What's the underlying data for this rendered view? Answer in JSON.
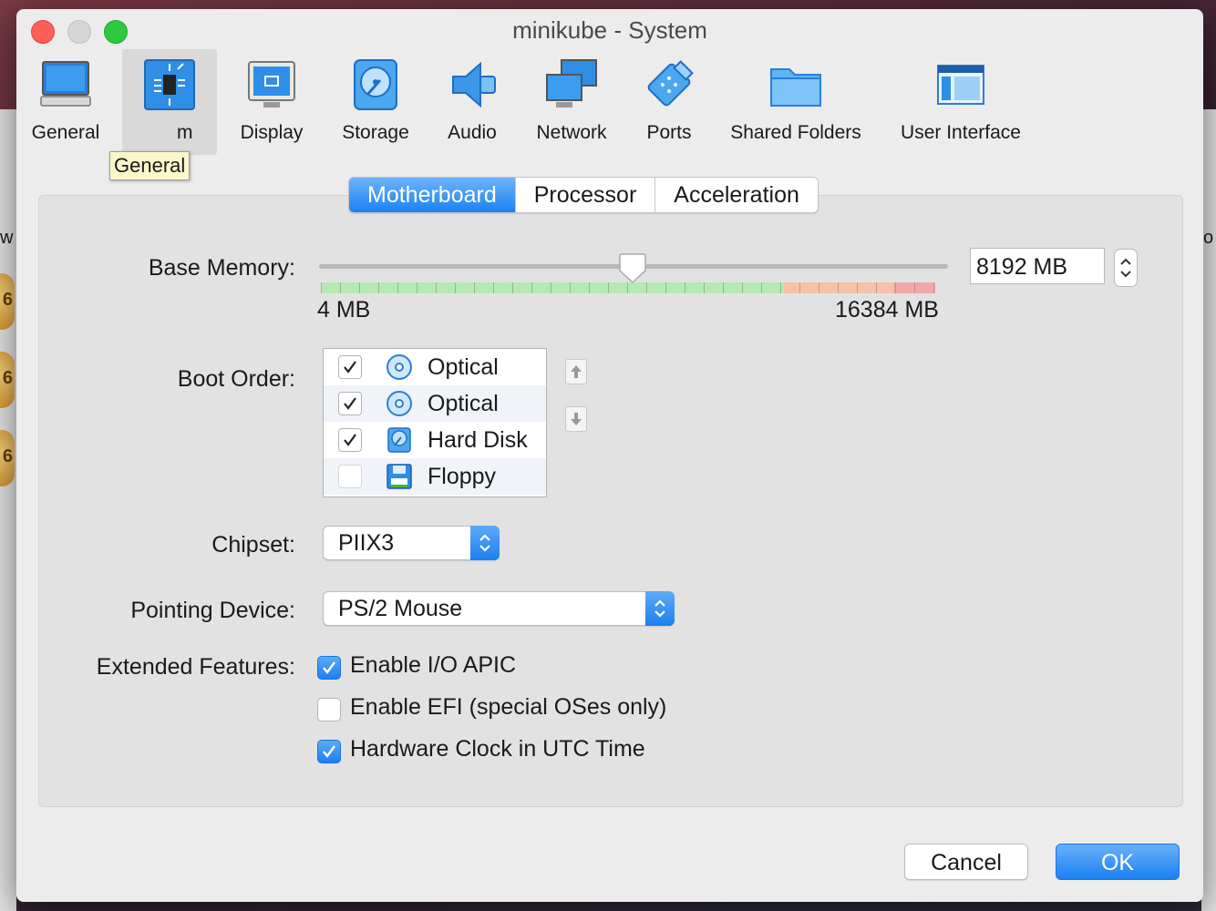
{
  "window": {
    "title": "minikube - System"
  },
  "background": {
    "badges": [
      "6",
      "6",
      "6"
    ],
    "left_text": "w",
    "right_text": "o"
  },
  "toolbar": {
    "items": [
      {
        "label": "General",
        "icon": "general-monitor-icon"
      },
      {
        "label": "m",
        "icon": "system-chip-icon",
        "selected": true
      },
      {
        "label": "Display",
        "icon": "display-icon"
      },
      {
        "label": "Storage",
        "icon": "storage-disk-icon"
      },
      {
        "label": "Audio",
        "icon": "audio-speaker-icon"
      },
      {
        "label": "Network",
        "icon": "network-icon"
      },
      {
        "label": "Ports",
        "icon": "ports-connector-icon"
      },
      {
        "label": "Shared Folders",
        "icon": "shared-folder-icon"
      },
      {
        "label": "User Interface",
        "icon": "user-interface-icon"
      }
    ],
    "tooltip": "General"
  },
  "tabs": [
    {
      "label": "Motherboard",
      "active": true
    },
    {
      "label": "Processor",
      "active": false
    },
    {
      "label": "Acceleration",
      "active": false
    }
  ],
  "memory": {
    "label": "Base Memory:",
    "value": "8192 MB",
    "value_mb": 8192,
    "min_label": "4 MB",
    "max_label": "16384 MB",
    "min_mb": 4,
    "max_mb": 16384
  },
  "boot": {
    "label": "Boot Order:",
    "items": [
      {
        "label": "Optical",
        "checked": true,
        "icon": "optical-disc-icon"
      },
      {
        "label": "Optical",
        "checked": true,
        "icon": "optical-disc-icon"
      },
      {
        "label": "Hard Disk",
        "checked": true,
        "icon": "hard-disk-icon"
      },
      {
        "label": "Floppy",
        "checked": false,
        "icon": "floppy-icon"
      }
    ]
  },
  "chipset": {
    "label": "Chipset:",
    "value": "PIIX3"
  },
  "pointing": {
    "label": "Pointing Device:",
    "value": "PS/2 Mouse"
  },
  "features": {
    "label": "Extended Features:",
    "items": [
      {
        "label": "Enable I/O APIC",
        "checked": true
      },
      {
        "label": "Enable EFI (special OSes only)",
        "checked": false
      },
      {
        "label": "Hardware Clock in UTC Time",
        "checked": true
      }
    ]
  },
  "buttons": {
    "cancel": "Cancel",
    "ok": "OK"
  },
  "colors": {
    "accent": "#1c82f2",
    "close": "#fc5f57",
    "maximize": "#2bc840"
  }
}
